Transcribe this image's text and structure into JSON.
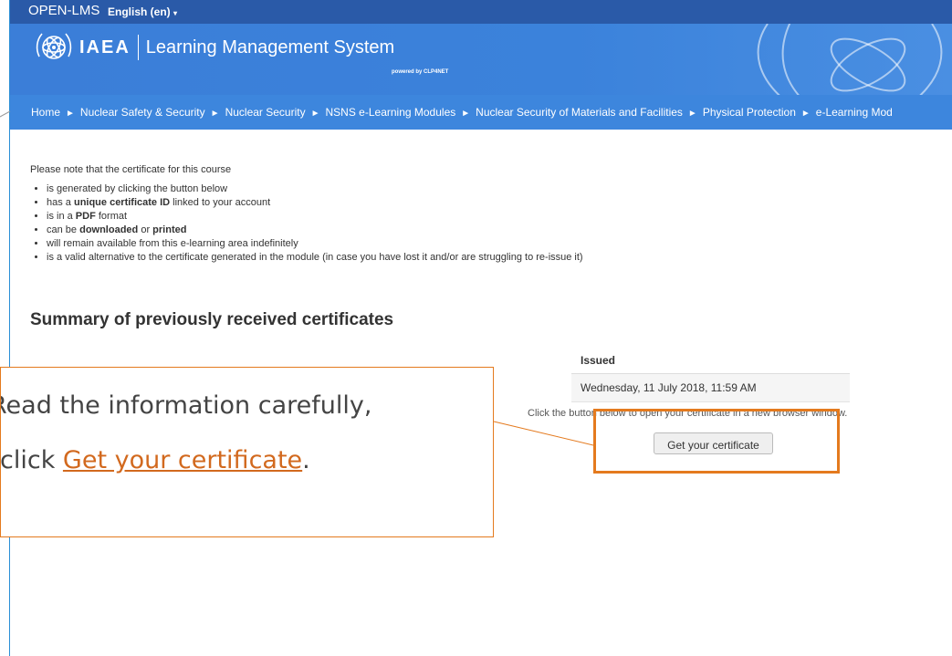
{
  "topbar": {
    "brand": "OPEN-LMS",
    "language": "English (en)"
  },
  "header": {
    "logo_text": "IAEA",
    "title": "Learning Management System",
    "powered_by": "powered by CLP4NET"
  },
  "breadcrumb": {
    "items": [
      "Home",
      "Nuclear Safety & Security",
      "Nuclear Security",
      "NSNS e-Learning Modules",
      "Nuclear Security of Materials and Facilities",
      "Physical Protection",
      "e-Learning Mod"
    ],
    "separator": "►"
  },
  "content": {
    "note": "Please note that the certificate for this course",
    "bullets": [
      {
        "pre": "is generated by clicking the button below",
        "bold": "",
        "post": ""
      },
      {
        "pre": "has a ",
        "bold": "unique certificate ID",
        "post": " linked to your account"
      },
      {
        "pre": "is in a ",
        "bold": "PDF",
        "post": " format"
      },
      {
        "pre": "can be ",
        "bold": "downloaded",
        "post": " or "
      },
      {
        "pre": "will remain available from this e-learning area indefinitely",
        "bold": "",
        "post": ""
      },
      {
        "pre": "is a valid alternative to the certificate generated in the module (in case you have lost it and/or are struggling to re-issue it)",
        "bold": "",
        "post": ""
      }
    ],
    "bullet4_extra_bold": "printed",
    "summary_heading": "Summary of previously received certificates",
    "table": {
      "header": "Issued",
      "rows": [
        "Wednesday, 11 July 2018, 11:59 AM"
      ]
    },
    "instruction": "Click the button below to open your certificate in a new browser window.",
    "button_label": "Get your certificate"
  },
  "callout": {
    "line1": "Read the information carefully,",
    "line2_prefix": "click ",
    "line2_link": "Get your certificate",
    "line2_suffix": "."
  },
  "colors": {
    "topbar": "#2a5aa8",
    "header": "#3b7ed8",
    "accent_orange": "#e47a1e",
    "link_orange": "#d2691e"
  }
}
